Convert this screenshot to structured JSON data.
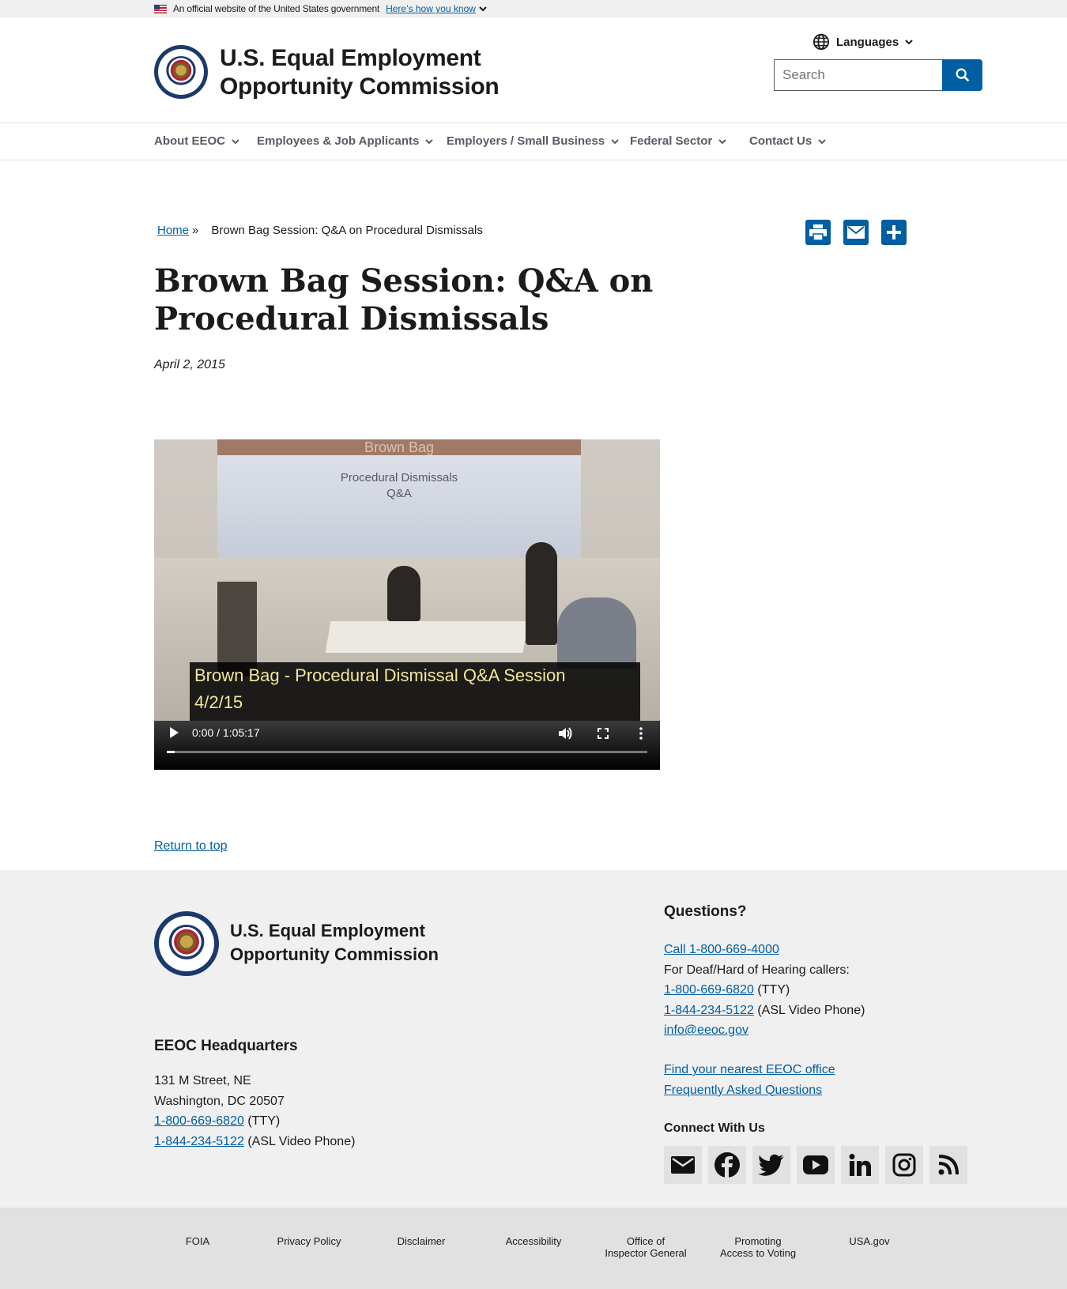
{
  "gov_banner": {
    "text": "An official website of the United States government",
    "link": "Here’s how you know"
  },
  "header": {
    "title_line1": "U.S. Equal Employment",
    "title_line2": "Opportunity Commission",
    "languages_label": "Languages",
    "search_placeholder": "Search"
  },
  "nav": {
    "items": [
      {
        "label": "About EEOC"
      },
      {
        "label": "Employees & Job Applicants"
      },
      {
        "label": "Employers / Small Business"
      },
      {
        "label": "Federal Sector"
      },
      {
        "label": "Contact Us"
      }
    ]
  },
  "breadcrumb": {
    "home": "Home",
    "separator": "»",
    "current": "Brown Bag Session: Q&A on Procedural Dismissals"
  },
  "page": {
    "title": "Brown Bag Session: Q&A on Procedural Dismissals",
    "date": "April 2, 2015"
  },
  "video": {
    "screen_title": "Brown Bag",
    "screen_line1": "Procedural Dismissals",
    "screen_line2": "Q&A",
    "caption_line1": "Brown Bag - Procedural Dismissal Q&A Session",
    "caption_line2": "4/2/15",
    "time": "0:00 / 1:05:17",
    "progress": 0.017
  },
  "return_to_top": "Return to top",
  "footer": {
    "title_line1": "U.S. Equal Employment",
    "title_line2": "Opportunity Commission",
    "hq_heading": "EEOC Headquarters",
    "hq_address1": "131 M Street, NE",
    "hq_address2": "Washington, DC 20507",
    "hq_tty_number": "1-800-669-6820",
    "hq_tty_suffix": " (TTY)",
    "hq_asl_number": "1-844-234-5122",
    "hq_asl_suffix": " (ASL Video Phone)",
    "questions_heading": "Questions?",
    "call_link": "Call 1-800-669-4000",
    "deaf_text": "For Deaf/Hard of Hearing callers:",
    "q_tty_number": "1-800-669-6820",
    "q_tty_suffix": " (TTY)",
    "q_asl_number": "1-844-234-5122",
    "q_asl_suffix": " (ASL Video Phone)",
    "email": "info@eeoc.gov",
    "find_office": "Find your nearest EEOC office",
    "faq": "Frequently Asked Questions",
    "connect_heading": "Connect With Us",
    "social_icons": [
      "email-icon",
      "facebook-icon",
      "twitter-icon",
      "youtube-icon",
      "linkedin-icon",
      "instagram-icon",
      "rss-icon"
    ]
  },
  "bottom_links": [
    {
      "line1": "FOIA",
      "line2": ""
    },
    {
      "line1": "Privacy Policy",
      "line2": ""
    },
    {
      "line1": "Disclaimer",
      "line2": ""
    },
    {
      "line1": "Accessibility",
      "line2": ""
    },
    {
      "line1": "Office of",
      "line2": "Inspector General"
    },
    {
      "line1": "Promoting",
      "line2": "Access to Voting"
    },
    {
      "line1": "USA.gov",
      "line2": ""
    }
  ],
  "colors": {
    "primary": "#005ea2",
    "footer_bg": "#f0f0f0",
    "bottom_bg": "#e1e1e1"
  }
}
